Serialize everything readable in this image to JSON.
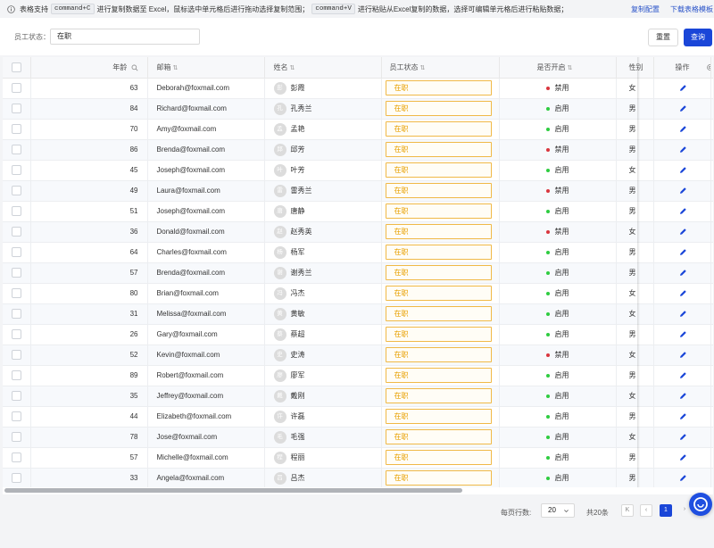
{
  "banner": {
    "text1": "表格支持",
    "key1": "command+C",
    "text2": "进行复制数据至 Excel，鼠标选中单元格后进行拖动选择复制范围；",
    "key2": "command+V",
    "text3": "进行粘贴从Excel复制的数据，选择可编辑单元格后进行粘贴数据；",
    "link_copy": "复制配置",
    "link_download": "下载表格模板"
  },
  "filter": {
    "label": "员工状态：",
    "value": "在职",
    "reset": "重置",
    "search": "查询"
  },
  "columns": {
    "age": "年龄",
    "email": "邮箱",
    "name": "姓名",
    "status": "员工状态",
    "enabled": "是否开启",
    "sex": "性别",
    "op": "操作"
  },
  "colors": {
    "primary": "#1a46d8",
    "enabled_dot": "#2ecc40",
    "disabled_dot": "#d9363e",
    "status_border": "#f0b947",
    "status_text": "#e8a000"
  },
  "rows": [
    {
      "age": "63",
      "email": "Deborah@foxmail.com",
      "avatar": "彭",
      "name": "彭霞",
      "status": "在职",
      "enabled": "禁用",
      "on": false,
      "sex": "女"
    },
    {
      "age": "84",
      "email": "Richard@foxmail.com",
      "avatar": "孔",
      "name": "孔秀兰",
      "status": "在职",
      "enabled": "启用",
      "on": true,
      "sex": "男"
    },
    {
      "age": "70",
      "email": "Amy@foxmail.com",
      "avatar": "孟",
      "name": "孟艳",
      "status": "在职",
      "enabled": "启用",
      "on": true,
      "sex": "男"
    },
    {
      "age": "86",
      "email": "Brenda@foxmail.com",
      "avatar": "邱",
      "name": "邱芳",
      "status": "在职",
      "enabled": "禁用",
      "on": false,
      "sex": "男"
    },
    {
      "age": "45",
      "email": "Joseph@foxmail.com",
      "avatar": "叶",
      "name": "叶芳",
      "status": "在职",
      "enabled": "启用",
      "on": true,
      "sex": "女"
    },
    {
      "age": "49",
      "email": "Laura@foxmail.com",
      "avatar": "雷",
      "name": "雷秀兰",
      "status": "在职",
      "enabled": "禁用",
      "on": false,
      "sex": "男"
    },
    {
      "age": "51",
      "email": "Joseph@foxmail.com",
      "avatar": "唐",
      "name": "唐静",
      "status": "在职",
      "enabled": "启用",
      "on": true,
      "sex": "男"
    },
    {
      "age": "36",
      "email": "Donald@foxmail.com",
      "avatar": "赵",
      "name": "赵秀英",
      "status": "在职",
      "enabled": "禁用",
      "on": false,
      "sex": "女"
    },
    {
      "age": "64",
      "email": "Charles@foxmail.com",
      "avatar": "杨",
      "name": "杨军",
      "status": "在职",
      "enabled": "启用",
      "on": true,
      "sex": "男"
    },
    {
      "age": "57",
      "email": "Brenda@foxmail.com",
      "avatar": "谢",
      "name": "谢秀兰",
      "status": "在职",
      "enabled": "启用",
      "on": true,
      "sex": "男"
    },
    {
      "age": "80",
      "email": "Brian@foxmail.com",
      "avatar": "冯",
      "name": "冯杰",
      "status": "在职",
      "enabled": "启用",
      "on": true,
      "sex": "女"
    },
    {
      "age": "31",
      "email": "Melissa@foxmail.com",
      "avatar": "黄",
      "name": "黄敏",
      "status": "在职",
      "enabled": "启用",
      "on": true,
      "sex": "女"
    },
    {
      "age": "26",
      "email": "Gary@foxmail.com",
      "avatar": "蔡",
      "name": "蔡超",
      "status": "在职",
      "enabled": "启用",
      "on": true,
      "sex": "男"
    },
    {
      "age": "52",
      "email": "Kevin@foxmail.com",
      "avatar": "史",
      "name": "史涛",
      "status": "在职",
      "enabled": "禁用",
      "on": false,
      "sex": "女"
    },
    {
      "age": "89",
      "email": "Robert@foxmail.com",
      "avatar": "廖",
      "name": "廖军",
      "status": "在职",
      "enabled": "启用",
      "on": true,
      "sex": "男"
    },
    {
      "age": "35",
      "email": "Jeffrey@foxmail.com",
      "avatar": "戴",
      "name": "戴刚",
      "status": "在职",
      "enabled": "启用",
      "on": true,
      "sex": "女"
    },
    {
      "age": "44",
      "email": "Elizabeth@foxmail.com",
      "avatar": "许",
      "name": "许磊",
      "status": "在职",
      "enabled": "启用",
      "on": true,
      "sex": "男"
    },
    {
      "age": "78",
      "email": "Jose@foxmail.com",
      "avatar": "毛",
      "name": "毛强",
      "status": "在职",
      "enabled": "启用",
      "on": true,
      "sex": "女"
    },
    {
      "age": "57",
      "email": "Michelle@foxmail.com",
      "avatar": "程",
      "name": "程丽",
      "status": "在职",
      "enabled": "启用",
      "on": true,
      "sex": "男"
    },
    {
      "age": "33",
      "email": "Angela@foxmail.com",
      "avatar": "吕",
      "name": "吕杰",
      "status": "在职",
      "enabled": "启用",
      "on": true,
      "sex": "男"
    }
  ],
  "pagination": {
    "per_page_label": "每页行数:",
    "per_page": "20",
    "total": "共20条",
    "first": "K",
    "prev": "‹",
    "current": "1",
    "next": "›"
  }
}
